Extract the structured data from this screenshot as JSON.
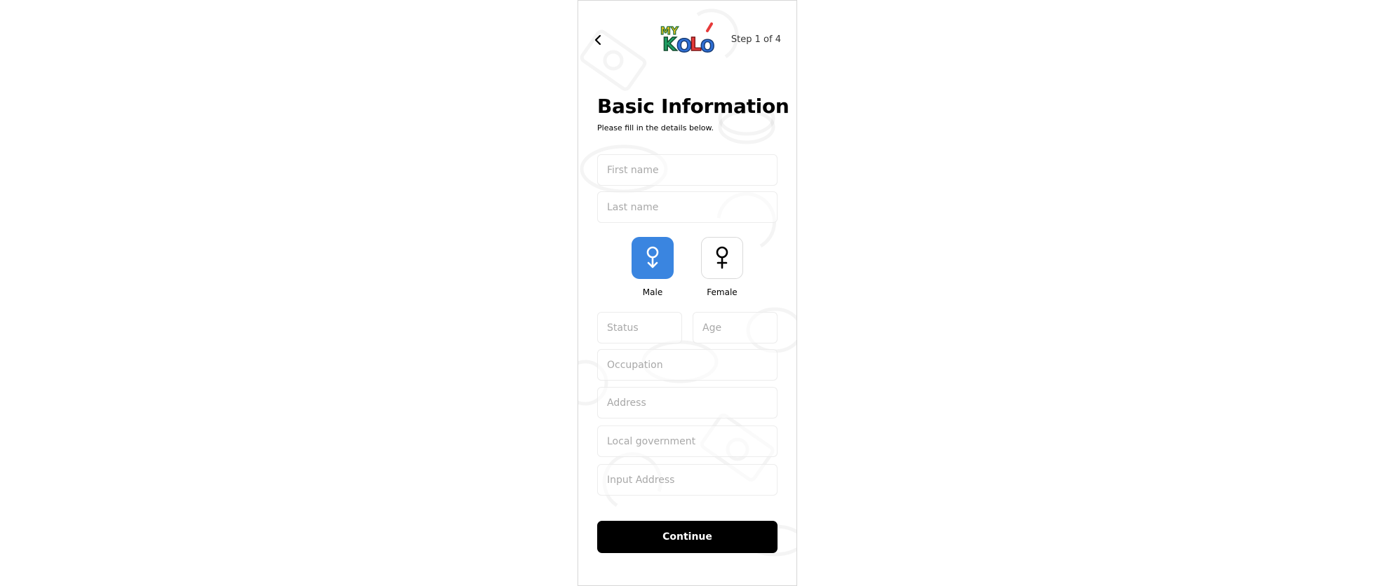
{
  "header": {
    "step_text": "Step 1 of 4",
    "logo_text": "MY KOLO"
  },
  "title": "Basic Information",
  "subtitle": "Please fill in the details below.",
  "fields": {
    "first_name": "First name",
    "last_name": "Last name",
    "status": "Status",
    "age": "Age",
    "occupation": "Occupation",
    "address": "Address",
    "local_government": "Local government",
    "input_address": "Input Address"
  },
  "gender": {
    "male_label": "Male",
    "female_label": "Female",
    "selected": "male"
  },
  "continue_label": "Continue",
  "colors": {
    "accent": "#3a85e0",
    "button": "#000000"
  }
}
